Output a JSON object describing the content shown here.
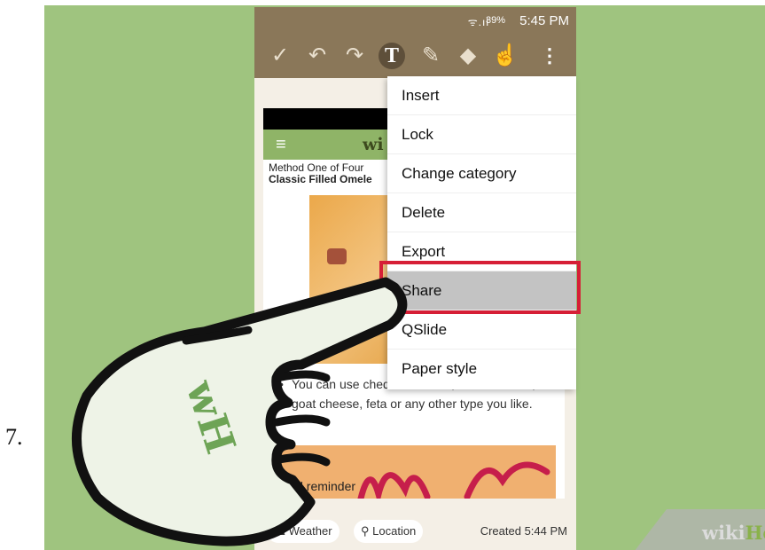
{
  "step_number": "7.",
  "status_bar": {
    "signal": "ᯤ.ıl",
    "battery": "39%",
    "time": "5:45 PM"
  },
  "toolbar": {
    "icons": [
      "check-icon",
      "undo-icon",
      "redo-icon",
      "text-icon",
      "pen-icon",
      "eraser-icon",
      "selection-icon",
      "more-icon"
    ],
    "text_tool_label": "T"
  },
  "webpage": {
    "site_logo": "wi",
    "method_label": "Method One of Four",
    "method_title": "Classic Filled Omele",
    "bullet_text": "You can use cheddar cheese, swiss cheese, goat cheese, feta or any other type you like."
  },
  "menu": {
    "items": [
      "Insert",
      "Lock",
      "Change category",
      "Delete",
      "Export",
      "Share",
      "QSlide",
      "Paper style"
    ],
    "selected": "Share"
  },
  "footer": {
    "reminder": "Add reminder",
    "weather": "Weather",
    "location": "Location",
    "created": "Created 5:44 PM"
  },
  "hand_badge": "wH",
  "watermark": {
    "wiki": "wiki",
    "how": "How"
  },
  "colors": {
    "background": "#9fc47f",
    "toolbar": "#8a7759",
    "highlight": "#d61f36",
    "selected_item": "#c3c3c3"
  }
}
